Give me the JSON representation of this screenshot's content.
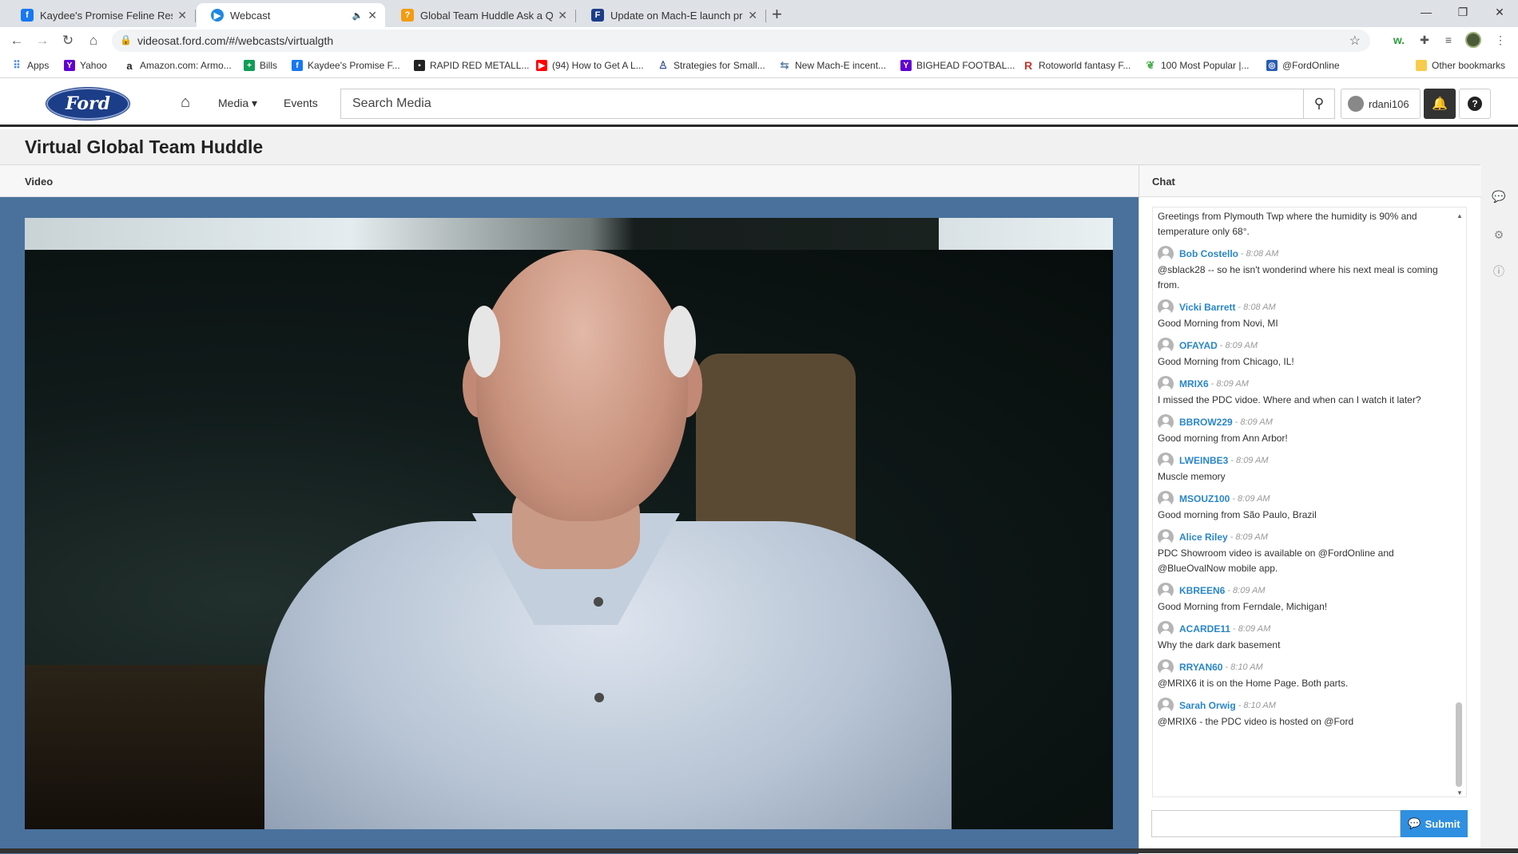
{
  "browser": {
    "tabs": [
      {
        "title": "Kaydee's Promise Feline Rescue -",
        "favicon": "facebook-icon",
        "color": "#1877f2",
        "active": false
      },
      {
        "title": "Webcast",
        "favicon": "webcast-icon",
        "color": "#1e88e5",
        "active": true
      },
      {
        "title": "Global Team Huddle Ask a Quest",
        "favicon": "question-icon",
        "color": "#f39c12",
        "active": false
      },
      {
        "title": "Update on Mach-E launch progre",
        "favicon": "ford-tab-icon",
        "color": "#1c3d88",
        "active": false
      }
    ],
    "url": "videosat.ford.com/#/webcasts/virtualgth",
    "bookmarks": [
      {
        "label": "Apps",
        "icon": "apps-grid-icon",
        "color": "#4285f4"
      },
      {
        "label": "Yahoo",
        "icon": "yahoo-icon",
        "color": "#6001d2"
      },
      {
        "label": "Amazon.com: Armo...",
        "icon": "amazon-icon",
        "color": "#222222"
      },
      {
        "label": "Bills",
        "icon": "bills-icon",
        "color": "#0f9d58"
      },
      {
        "label": "Kaydee's Promise F...",
        "icon": "facebook-icon",
        "color": "#1877f2"
      },
      {
        "label": "RAPID RED METALL...",
        "icon": "ford-bm-icon",
        "color": "#1c3d88"
      },
      {
        "label": "(94) How to Get A L...",
        "icon": "youtube-icon",
        "color": "#ff0000"
      },
      {
        "label": "Strategies for Small...",
        "icon": "person-bm-icon",
        "color": "#3b5998"
      },
      {
        "label": "New Mach-E incent...",
        "icon": "mache-icon",
        "color": "#5b7fa6"
      },
      {
        "label": "BIGHEAD FOOTBAL...",
        "icon": "yahoo-icon",
        "color": "#6001d2"
      },
      {
        "label": "Rotoworld fantasy F...",
        "icon": "rotoworld-icon",
        "color": "#c0392b"
      },
      {
        "label": "100 Most Popular |...",
        "icon": "leaf-icon",
        "color": "#4caf50"
      },
      {
        "label": "@FordOnline",
        "icon": "ford-online-icon",
        "color": "#2a5db0"
      }
    ],
    "other_bookmarks": "Other bookmarks"
  },
  "site": {
    "logo": "Ford",
    "nav_media": "Media",
    "nav_events": "Events",
    "search_placeholder": "Search Media",
    "username": "rdani106"
  },
  "page": {
    "title": "Virtual Global Team Huddle",
    "video_label": "Video",
    "chat_label": "Chat",
    "submit_label": "Submit"
  },
  "chat": {
    "partial_message": "Greetings from Plymouth Twp where the humidity is 90% and temperature only 68°.",
    "messages": [
      {
        "name": "Bob Costello",
        "time": "8:08 AM",
        "text": "@sblack28 -- so he isn't wonderind where his next meal is coming from."
      },
      {
        "name": "Vicki Barrett",
        "time": "8:08 AM",
        "text": "Good Morning from Novi, MI"
      },
      {
        "name": "OFAYAD",
        "time": "8:09 AM",
        "text": "Good Morning from Chicago, IL!"
      },
      {
        "name": "MRIX6",
        "time": "8:09 AM",
        "text": "I missed the PDC vidoe. Where and when can I watch it later?"
      },
      {
        "name": "BBROW229",
        "time": "8:09 AM",
        "text": "Good morning from Ann Arbor!"
      },
      {
        "name": "LWEINBE3",
        "time": "8:09 AM",
        "text": "Muscle memory"
      },
      {
        "name": "MSOUZ100",
        "time": "8:09 AM",
        "text": "Good morning from São Paulo, Brazil"
      },
      {
        "name": "Alice Riley",
        "time": "8:09 AM",
        "text": "PDC Showroom video is available on @FordOnline and @BlueOvalNow mobile app."
      },
      {
        "name": "KBREEN6",
        "time": "8:09 AM",
        "text": "Good Morning from Ferndale, Michigan!"
      },
      {
        "name": "ACARDE11",
        "time": "8:09 AM",
        "text": "Why the dark dark basement"
      },
      {
        "name": "RRYAN60",
        "time": "8:10 AM",
        "text": "@MRIX6 it is on the Home Page. Both parts."
      },
      {
        "name": "Sarah Orwig",
        "time": "8:10 AM",
        "text": "@MRIX6 - the PDC video is hosted on @Ford"
      }
    ]
  }
}
